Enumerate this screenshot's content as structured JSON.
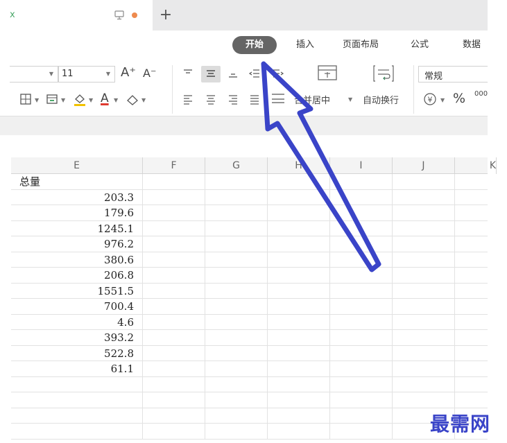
{
  "tabbar": {
    "close_mark": "x",
    "new_tab": "+"
  },
  "ribbon": {
    "tabs": {
      "home": "开始",
      "insert": "插入",
      "page_layout": "页面布局",
      "formula": "公式",
      "data": "数据"
    },
    "font_size": "11",
    "increase_font": "A⁺",
    "decrease_font": "A⁻",
    "font_color_letter": "A",
    "merge_center": "合并居中",
    "wrap_text": "自动换行",
    "number_format": "常规",
    "currency": "¥",
    "percent": "%",
    "thousands": "000"
  },
  "columns": [
    "E",
    "F",
    "G",
    "H",
    "I",
    "J",
    "K"
  ],
  "sheet": {
    "header": "总量",
    "values": [
      "203.3",
      "179.6",
      "1245.1",
      "976.2",
      "380.6",
      "206.8",
      "1551.5",
      "700.4",
      "4.6",
      "393.2",
      "522.8",
      "61.1"
    ]
  },
  "watermark": "最需网",
  "colors": {
    "arrow": "#3a44c8",
    "active_tab": "#656565",
    "doc_tab_mark": "#4ca86b",
    "unsaved_dot": "#ee8a4e"
  }
}
